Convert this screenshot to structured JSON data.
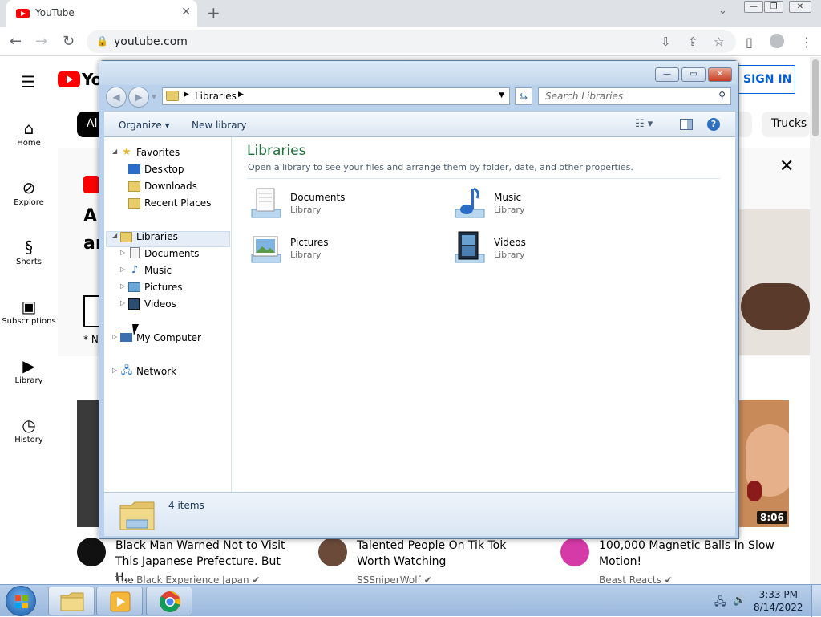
{
  "browser": {
    "tab_title": "YouTube",
    "tab_close": "✕",
    "new_tab": "+",
    "url": "youtube.com"
  },
  "youtube": {
    "logo_text": "Yo",
    "sign_in": "SIGN IN",
    "sidebar": [
      {
        "label": "Home",
        "icon": "home-icon"
      },
      {
        "label": "Explore",
        "icon": "compass-icon"
      },
      {
        "label": "Shorts",
        "icon": "shorts-icon"
      },
      {
        "label": "Subscriptions",
        "icon": "subscriptions-icon"
      },
      {
        "label": "Library",
        "icon": "library-icon"
      },
      {
        "label": "History",
        "icon": "history-icon"
      }
    ],
    "chips": {
      "first": "Al",
      "last": "Trucks"
    },
    "banner": {
      "line1": "A",
      "line2": "ar",
      "note": "* N"
    },
    "duration": "8:06",
    "videos": [
      {
        "title": "Black Man Warned Not to Visit This Japanese Prefecture. But H...",
        "channel": "The Black Experience Japan ✔"
      },
      {
        "title": "Talented People On Tik Tok Worth Watching",
        "channel": "SSSniperWolf ✔"
      },
      {
        "title": "100,000 Magnetic Balls In Slow Motion!",
        "channel": "Beast Reacts ✔"
      }
    ]
  },
  "explorer": {
    "address_label": "Libraries",
    "search_placeholder": "Search Libraries",
    "toolbar": {
      "organize": "Organize",
      "new_library": "New library"
    },
    "tree": {
      "favorites": "Favorites",
      "desktop": "Desktop",
      "downloads": "Downloads",
      "recent_places": "Recent Places",
      "libraries": "Libraries",
      "documents": "Documents",
      "music": "Music",
      "pictures": "Pictures",
      "videos": "Videos",
      "my_computer": "My Computer",
      "network": "Network"
    },
    "content": {
      "title": "Libraries",
      "subtitle": "Open a library to see your files and arrange them by folder, date, and other properties.",
      "items": [
        {
          "name": "Documents",
          "type": "Library"
        },
        {
          "name": "Music",
          "type": "Library"
        },
        {
          "name": "Pictures",
          "type": "Library"
        },
        {
          "name": "Videos",
          "type": "Library"
        }
      ]
    },
    "status": "4 items"
  },
  "taskbar": {
    "time": "3:33 PM",
    "date": "8/14/2022"
  },
  "colors": {
    "yt_red": "#ff0000",
    "yt_blue": "#065fd4",
    "explorer_title_green": "#1e6f3a"
  }
}
